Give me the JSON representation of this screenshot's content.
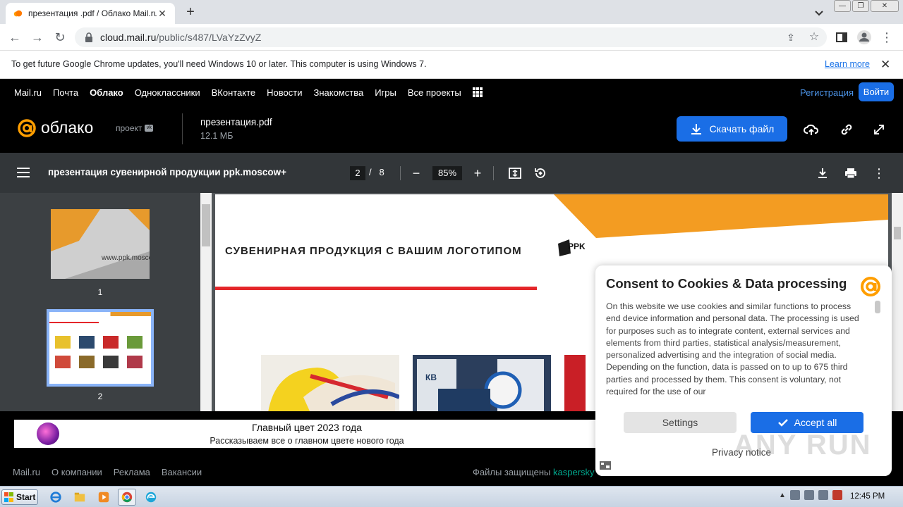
{
  "browser": {
    "tab_title": "презентация .pdf / Облако Mail.ru",
    "url_host": "cloud.mail.ru",
    "url_path": "/public/s487/LVaYzZvyZ",
    "info_message": "To get future Google Chrome updates, you'll need Windows 10 or later. This computer is using Windows 7.",
    "learn_more": "Learn more"
  },
  "mailnav": {
    "links": [
      "Mail.ru",
      "Почта",
      "Облако",
      "Одноклассники",
      "ВКонтакте",
      "Новости",
      "Знакомства",
      "Игры",
      "Все проекты"
    ],
    "register": "Регистрация",
    "login": "Войти"
  },
  "header": {
    "logo_text": "облако",
    "project_label": "проект",
    "file_name": "презентация.pdf",
    "file_size": "12.1 МБ",
    "download_label": "Скачать файл"
  },
  "pdf": {
    "doc_title": "презентация сувенирной продукции ppk.moscow+",
    "current_page": "2",
    "total_pages": "8",
    "page_sep": "/",
    "zoom": "85%",
    "thumbs": [
      "1",
      "2"
    ],
    "thumb1_text": "www.ppk.moscow",
    "page_heading": "СУВЕНИРНАЯ ПРОДУКЦИЯ С ВАШИМ ЛОГОТИПОМ",
    "logo_text": "PPK"
  },
  "ad": {
    "title": "Главный цвет 2023 года",
    "subtitle": "Рассказываем все о главном цвете нового года"
  },
  "footer": {
    "links": [
      "Mail.ru",
      "О компании",
      "Реклама",
      "Вакансии"
    ],
    "protected_prefix": "Файлы защищены",
    "protected_brand": "kaspersky"
  },
  "consent": {
    "title": "Consent to Cookies & Data processing",
    "body": "On this website we use cookies and similar functions to process end device information and personal data. The processing is used for purposes such as to integrate content, external services and elements from third parties, statistical analysis/measurement, personalized advertising and the integration of social media. Depending on the function, data is passed on to up to 675 third parties and processed by them. This consent is voluntary, not required for the use of our",
    "settings": "Settings",
    "accept": "Accept all",
    "privacy": "Privacy notice"
  },
  "watermark": "ANY RUN",
  "taskbar": {
    "start": "Start",
    "clock": "12:45 PM"
  },
  "colors": {
    "accent_blue": "#1a6ee6",
    "oblako_orange": "#ff9e00",
    "pdf_toolbar": "#323639"
  }
}
